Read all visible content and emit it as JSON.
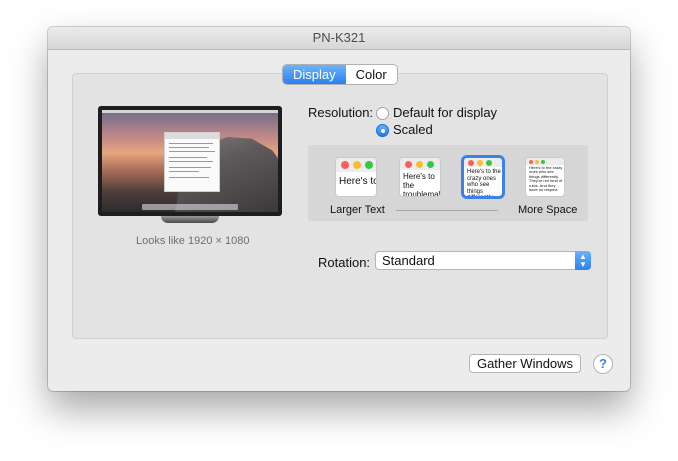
{
  "window": {
    "title": "PN-K321"
  },
  "tabs": [
    {
      "label": "Display",
      "active": true
    },
    {
      "label": "Color",
      "active": false
    }
  ],
  "display": {
    "looks_like": "Looks like 1920 × 1080"
  },
  "resolution": {
    "label": "Resolution:",
    "options": [
      {
        "label": "Default for display",
        "selected": false
      },
      {
        "label": "Scaled",
        "selected": true
      }
    ]
  },
  "scaling": {
    "thumb_texts": [
      "Here's to",
      "Here's to the troublemakers",
      "Here's to the crazy ones who see things differently rules. And they",
      "Here's to the crazy ones who see things differently. They're not fond of rules. And they have no respect"
    ],
    "selected_index": 2,
    "left_caption": "Larger Text",
    "right_caption": "More Space"
  },
  "rotation": {
    "label": "Rotation:",
    "value": "Standard"
  },
  "buttons": {
    "gather": "Gather Windows",
    "help": "?"
  },
  "colors": {
    "accent": "#2b80f1",
    "traffic_red": "#fc5f57",
    "traffic_yellow": "#fdbc2e",
    "traffic_green": "#33c748"
  }
}
